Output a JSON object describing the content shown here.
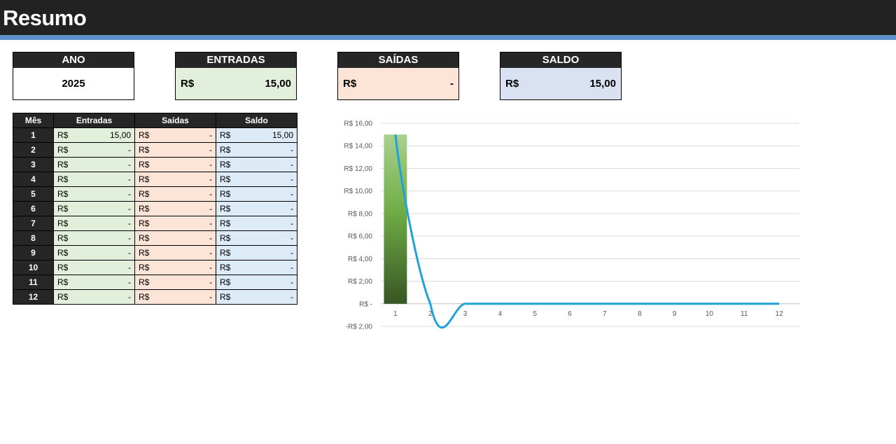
{
  "title": "Resumo",
  "cards": {
    "ano": {
      "label": "ANO",
      "value": "2025"
    },
    "entradas": {
      "label": "ENTRADAS",
      "currency": "R$",
      "value": "15,00"
    },
    "saidas": {
      "label": "SAÍDAS",
      "currency": "R$",
      "value": "-"
    },
    "saldo": {
      "label": "SALDO",
      "currency": "R$",
      "value": "15,00"
    }
  },
  "table": {
    "headers": [
      "Mês",
      "Entradas",
      "Saídas",
      "Saldo"
    ],
    "currency": "R$",
    "rows": [
      {
        "mes": "1",
        "entradas": "15,00",
        "saidas": "-",
        "saldo": "15,00"
      },
      {
        "mes": "2",
        "entradas": "-",
        "saidas": "-",
        "saldo": "-"
      },
      {
        "mes": "3",
        "entradas": "-",
        "saidas": "-",
        "saldo": "-"
      },
      {
        "mes": "4",
        "entradas": "-",
        "saidas": "-",
        "saldo": "-"
      },
      {
        "mes": "5",
        "entradas": "-",
        "saidas": "-",
        "saldo": "-"
      },
      {
        "mes": "6",
        "entradas": "-",
        "saidas": "-",
        "saldo": "-"
      },
      {
        "mes": "7",
        "entradas": "-",
        "saidas": "-",
        "saldo": "-"
      },
      {
        "mes": "8",
        "entradas": "-",
        "saidas": "-",
        "saldo": "-"
      },
      {
        "mes": "9",
        "entradas": "-",
        "saidas": "-",
        "saldo": "-"
      },
      {
        "mes": "10",
        "entradas": "-",
        "saidas": "-",
        "saldo": "-"
      },
      {
        "mes": "11",
        "entradas": "-",
        "saidas": "-",
        "saldo": "-"
      },
      {
        "mes": "12",
        "entradas": "-",
        "saidas": "-",
        "saldo": "-"
      }
    ]
  },
  "colors": {
    "header_dark": "#262626",
    "accent_blue": "#5b8fc8",
    "entradas_bg": "#e2efda",
    "saidas_bg": "#fce4d6",
    "saldo_bg": "#ddebf7",
    "saldo_card_bg": "#d9e1f2",
    "bar_green": "#70ad47",
    "line_blue": "#1fa2d6"
  },
  "chart_data": {
    "type": "bar",
    "categories": [
      "1",
      "2",
      "3",
      "4",
      "5",
      "6",
      "7",
      "8",
      "9",
      "10",
      "11",
      "12"
    ],
    "series": [
      {
        "type": "bar",
        "values": [
          15,
          0,
          0,
          0,
          0,
          0,
          0,
          0,
          0,
          0,
          0,
          0
        ]
      },
      {
        "type": "line",
        "smooth": true,
        "values": [
          15,
          0,
          0,
          0,
          0,
          0,
          0,
          0,
          0,
          0,
          0,
          0
        ]
      }
    ],
    "yticks": [
      "R$ 16,00",
      "R$ 14,00",
      "R$ 12,00",
      "R$ 10,00",
      "R$ 8,00",
      "R$ 6,00",
      "R$ 4,00",
      "R$ 2,00",
      "R$ -",
      "-R$ 2,00"
    ],
    "ytick_values": [
      16,
      14,
      12,
      10,
      8,
      6,
      4,
      2,
      0,
      -2
    ],
    "ylim": [
      -2,
      16
    ],
    "grid": true,
    "legend": "none"
  }
}
